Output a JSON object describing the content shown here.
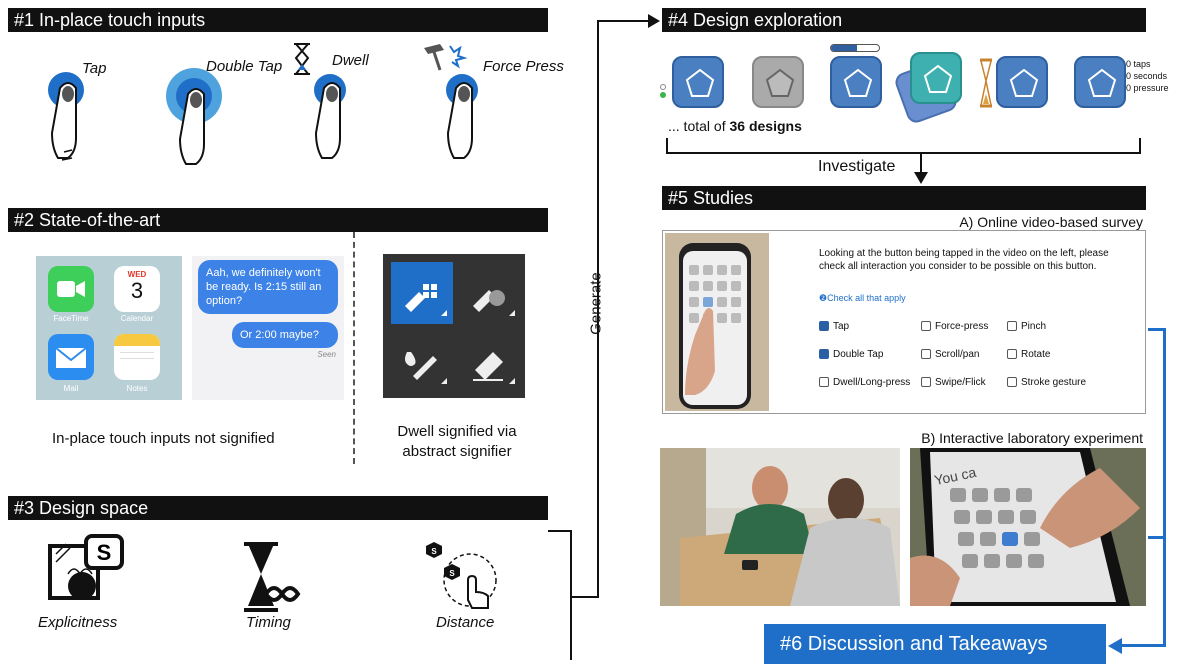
{
  "sections": {
    "s1": "#1 In-place touch inputs",
    "s2": "#2 State-of-the-art",
    "s3": "#3 Design space",
    "s4": "#4 Design exploration",
    "s5": "#5 Studies",
    "s6": "#6 Discussion and Takeaways"
  },
  "touch_inputs": [
    "Tap",
    "Double Tap",
    "Dwell",
    "Force Press"
  ],
  "state_of_art": {
    "apps": [
      "FaceTime",
      "Calendar",
      "Mail",
      "Notes"
    ],
    "calendar_day": "WED",
    "calendar_date": "3",
    "msg1": "Aah, we definitely won't be ready. Is 2:15 still an option?",
    "msg2": "Or 2:00 maybe?",
    "seen": "Seen",
    "caption_left": "In-place touch inputs not signified",
    "caption_right": "Dwell signified via abstract signifier"
  },
  "design_space": [
    "Explicitness",
    "Timing",
    "Distance"
  ],
  "exploration": {
    "total_prefix": "... total of ",
    "total_bold": "36 designs",
    "counters": [
      "0 taps",
      "0 seconds",
      "0 pressure"
    ]
  },
  "edges": {
    "generate": "Generate",
    "investigate": "Investigate"
  },
  "studies": {
    "a_title": "A) Online video-based survey",
    "b_title": "B) Interactive laboratory experiment",
    "question": "Looking at the button being tapped in the video on the left, please check all interaction you consider to be possible on this button.",
    "hint": "❷Check all that apply",
    "options": [
      "Tap",
      "Force-press",
      "Pinch",
      "Double Tap",
      "Scroll/pan",
      "Rotate",
      "Dwell/Long-press",
      "Swipe/Flick",
      "Stroke gesture"
    ],
    "phone_text": "You ca"
  },
  "colors": {
    "accent_blue": "#1f6fc8",
    "tile_blue": "#4a7fc1",
    "bar_black": "#111111"
  }
}
